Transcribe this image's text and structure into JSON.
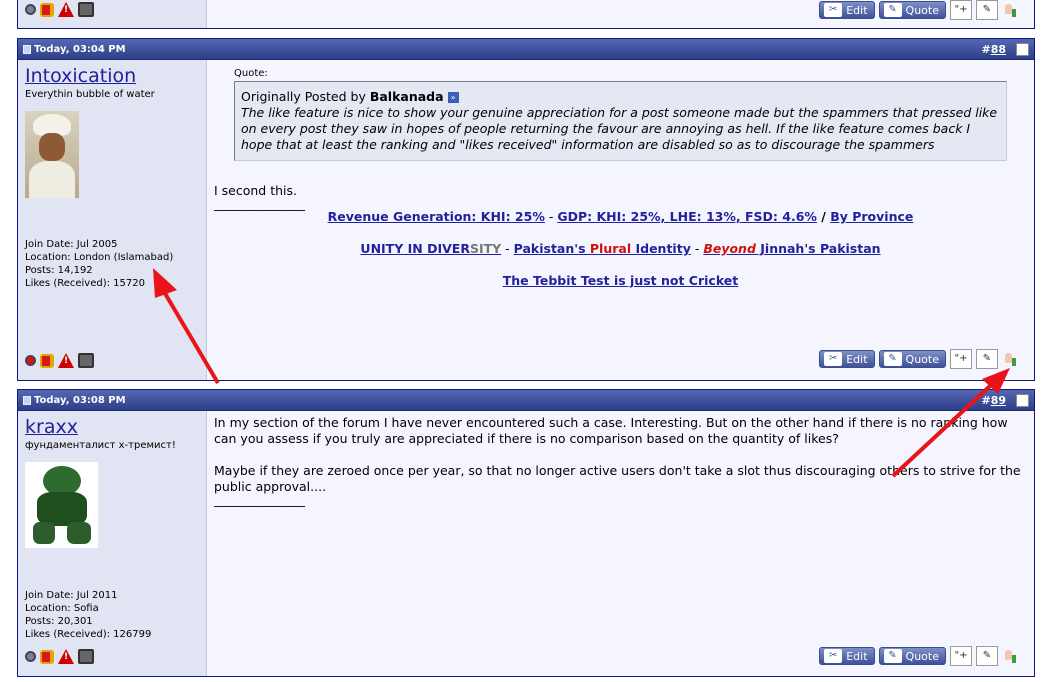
{
  "top_strip": {
    "buttons": {
      "edit": "Edit",
      "quote": "Quote"
    }
  },
  "post88": {
    "date": "Today, 03:04 PM",
    "number": "88",
    "user": {
      "name": "Intoxication",
      "title": "Everythin bubble of water",
      "join": "Join Date: Jul 2005",
      "location": "Location: London (Islamabad)",
      "posts": "Posts: 14,192",
      "likes": "Likes (Received): 15720"
    },
    "quote_label": "Quote:",
    "quote_prefix": "Originally Posted by ",
    "quote_author": "Balkanada",
    "quote_text": "The like feature is nice to show your genuine appreciation for a post someone made but the spammers that pressed like on every post they saw in hopes of people returning the favour are annoying as hell. If the like feature comes back I hope that at least the ranking and \"likes received\" information are disabled so as to discourage the spammers",
    "message": "I second this.",
    "sig_line": "__________________",
    "sig1": {
      "a": "Revenue Generation: KHI: 25%",
      "sep1": " - ",
      "b": "GDP: KHI: 25%, LHE: 13%, FSD: 4.6%",
      "sep2": " / ",
      "c": "By Province"
    },
    "sig2": {
      "unity": "UNITY IN DIVER",
      "sity": "SITY",
      "sep1": " - ",
      "pk_a": "Pakistan's ",
      "plural": "Plural",
      "pk_b": " Identity",
      "sep2": " - ",
      "beyond": "Beyond",
      "jinnah": " Jinnah's Pakistan"
    },
    "sig3": "The Tebbit Test is just not Cricket",
    "buttons": {
      "edit": "Edit",
      "quote": "Quote"
    }
  },
  "post89": {
    "date": "Today, 03:08 PM",
    "number": "89",
    "user": {
      "name": "kraxx",
      "title": "фундаменталист х-тремист!",
      "join": "Join Date: Jul 2011",
      "location": "Location: Sofia",
      "posts": "Posts: 20,301",
      "likes": "Likes (Received): 126799"
    },
    "message1": "In my section of the forum I have never encountered such a case. Interesting. But on the other hand if there is no ranking how can you assess if you truly are appreciated if there is no comparison based on the quantity of likes?",
    "message2": "Maybe if they are zeroed once per year, so that no longer active users don't take a slot thus discouraging others to strive for the public approval....",
    "sig_line": "__________________",
    "buttons": {
      "edit": "Edit",
      "quote": "Quote"
    }
  },
  "colors": {
    "header": "#2d3f8a",
    "link": "#22229c",
    "arrow": "#e8141a"
  }
}
